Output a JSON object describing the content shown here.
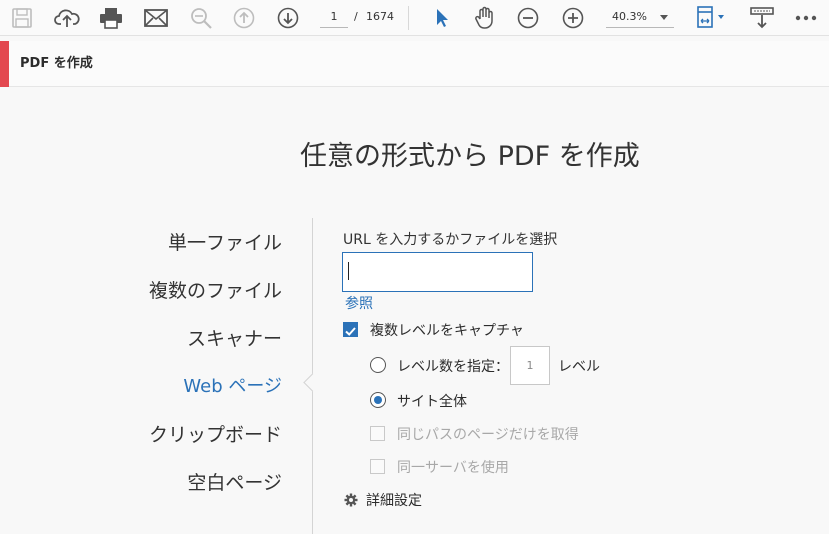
{
  "toolbar": {
    "icons": [
      "save-icon",
      "upload-cloud-icon",
      "print-icon",
      "mail-icon",
      "zoom-out-magnifier-icon",
      "page-up-icon",
      "page-down-icon",
      "select-arrow-icon",
      "hand-tool-icon",
      "zoom-out-icon",
      "zoom-in-icon",
      "page-fit-icon",
      "scroll-mode-icon",
      "more-icon"
    ],
    "page_current": "1",
    "page_separator": "/",
    "page_total": "1674",
    "zoom": "40.3%"
  },
  "titlebar": {
    "title": "PDF を作成",
    "accent_color": "#e34850"
  },
  "main": {
    "heading": "任意の形式から PDF を作成"
  },
  "nav": {
    "items": [
      "単一ファイル",
      "複数のファイル",
      "スキャナー",
      "Web ページ",
      "クリップボード",
      "空白ページ"
    ],
    "active": "Web ページ"
  },
  "web": {
    "url_label": "URL を入力するかファイルを選択",
    "url_value": "",
    "browse": "参照",
    "capture_levels": {
      "label": "複数レベルをキャプチャ",
      "checked": true
    },
    "level_option": {
      "label": "レベル数を指定：",
      "value": "1",
      "suffix": "レベル",
      "selected": false
    },
    "whole_site": {
      "label": "サイト全体",
      "selected": true
    },
    "same_path": {
      "label": "同じパスのページだけを取得",
      "checked": false,
      "disabled": true
    },
    "same_server": {
      "label": "同一サーバを使用",
      "checked": false,
      "disabled": true
    },
    "advanced": "詳細設定"
  },
  "colors": {
    "accent": "#2b72b8"
  }
}
